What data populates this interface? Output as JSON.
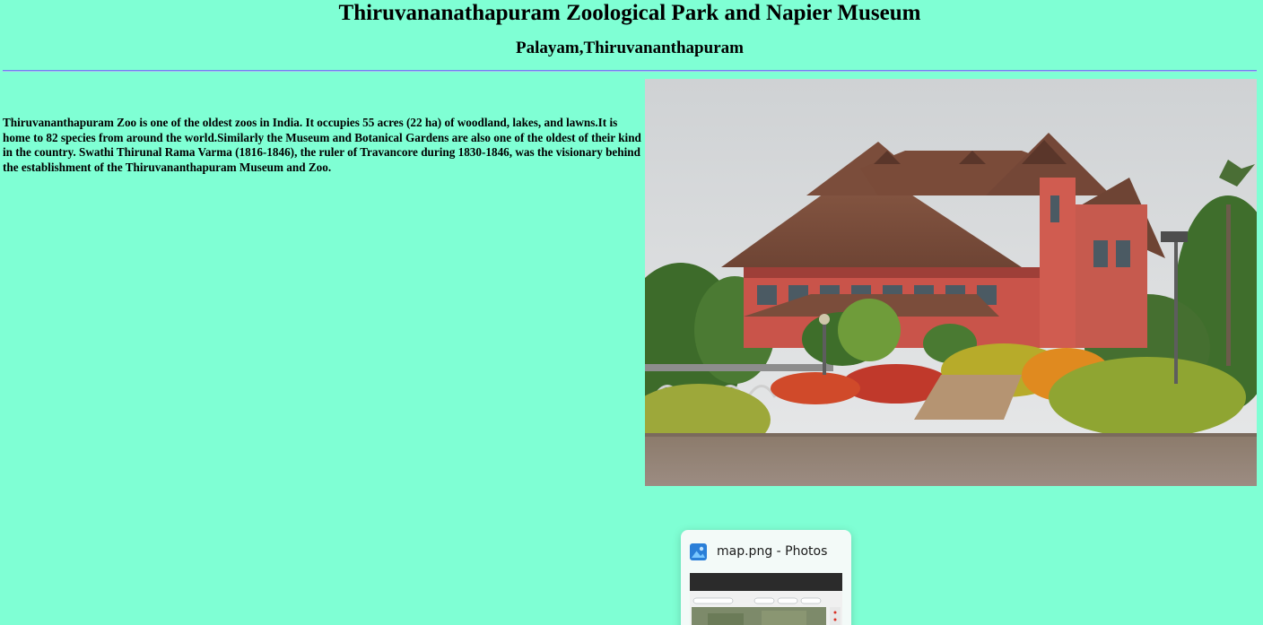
{
  "header": {
    "title": "Thiruvananathapuram Zoological Park and Napier Museum",
    "subtitle": "Palayam,Thiruvananthapuram"
  },
  "content": {
    "paragraph": "Thiruvananthapuram Zoo is one of the oldest zoos in India. It occupies 55 acres (22 ha) of woodland, lakes, and lawns.It is home to 82 species from around the world.Similarly the Museum and Botanical Gardens are also one of the oldest of their kind in the country. Swathi Thirunal Rama Varma (1816-1846), the ruler of Travancore during 1830-1846, was the visionary behind the establishment of the Thiruvananthapuram Museum and Zoo."
  },
  "taskbar_preview": {
    "window_title": "map.png - Photos",
    "app_icon": "photos-app-icon"
  },
  "colors": {
    "page_background": "#7fffd4",
    "divider": "#6d83ef",
    "preview_card": "#f3faf8"
  }
}
